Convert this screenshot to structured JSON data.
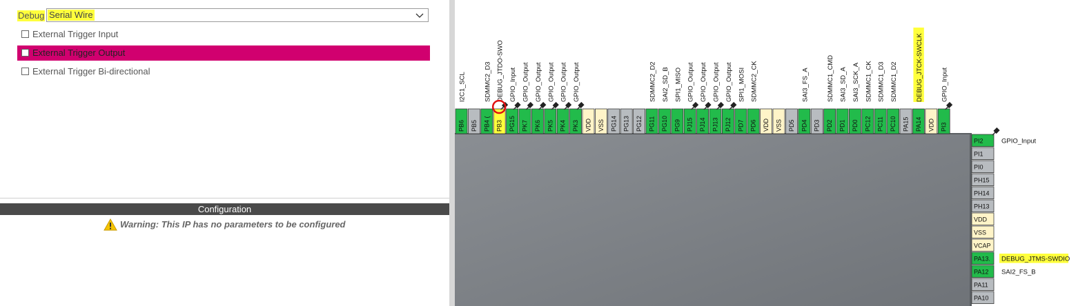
{
  "mode": {
    "debug_label": "Debug",
    "debug_value": "Serial Wire",
    "checkboxes": [
      {
        "label": "External Trigger Input",
        "checked": false,
        "selected": false
      },
      {
        "label": "External Trigger Output",
        "checked": false,
        "selected": true
      },
      {
        "label": "External Trigger Bi-directional",
        "checked": false,
        "selected": false
      }
    ]
  },
  "configuration": {
    "title": "Configuration",
    "warning": "Warning: This IP has no parameters to be configured"
  },
  "colors": {
    "gpio_green": "#22bb4b",
    "gray_pin": "#b8bcc0",
    "power_pin": "#fff4c8",
    "highlight_yellow": "#ffff3c",
    "selected_row": "#d1006f",
    "chip_body": "#7d8186"
  },
  "top_pins": [
    {
      "name": "PB6",
      "type": "gpio",
      "label": "I2C1_SCL",
      "pinned": false
    },
    {
      "name": "PB5",
      "type": "gray",
      "label": "",
      "pinned": false
    },
    {
      "name": "PB4 (",
      "type": "gpio",
      "label": "SDMMC2_D3",
      "pinned": false
    },
    {
      "name": "PB3",
      "type": "yellow",
      "label": "DEBUG_JTDO-SWO",
      "pinned": true,
      "circled": true
    },
    {
      "name": "PG15",
      "type": "gpio",
      "label": "GPIO_Input",
      "pinned": true
    },
    {
      "name": "PK7",
      "type": "gpio",
      "label": "GPIO_Output",
      "pinned": true
    },
    {
      "name": "PK6",
      "type": "gpio",
      "label": "GPIO_Output",
      "pinned": true
    },
    {
      "name": "PK5",
      "type": "gpio",
      "label": "GPIO_Output",
      "pinned": true
    },
    {
      "name": "PK4",
      "type": "gpio",
      "label": "GPIO_Output",
      "pinned": true
    },
    {
      "name": "PK3",
      "type": "gpio",
      "label": "GPIO_Output",
      "pinned": true
    },
    {
      "name": "VDD",
      "type": "power",
      "label": "",
      "pinned": false
    },
    {
      "name": "VSS",
      "type": "power",
      "label": "",
      "pinned": false
    },
    {
      "name": "PG14",
      "type": "gray",
      "label": "",
      "pinned": false
    },
    {
      "name": "PG13",
      "type": "gray",
      "label": "",
      "pinned": false
    },
    {
      "name": "PG12",
      "type": "gray",
      "label": "",
      "pinned": false
    },
    {
      "name": "PG11",
      "type": "gpio",
      "label": "SDMMC2_D2",
      "pinned": false
    },
    {
      "name": "PG10",
      "type": "gpio",
      "label": "SAI2_SD_B",
      "pinned": false
    },
    {
      "name": "PG9",
      "type": "gpio",
      "label": "SPI1_MISO",
      "pinned": false
    },
    {
      "name": "PJ15",
      "type": "gpio",
      "label": "GPIO_Output",
      "pinned": true
    },
    {
      "name": "PJ14",
      "type": "gpio",
      "label": "GPIO_Output",
      "pinned": true
    },
    {
      "name": "PJ13",
      "type": "gpio",
      "label": "GPIO_Output",
      "pinned": true
    },
    {
      "name": "PJ12",
      "type": "gpio",
      "label": "GPIO_Output",
      "pinned": true
    },
    {
      "name": "PD7",
      "type": "gpio",
      "label": "SPI1_MOSI",
      "pinned": false
    },
    {
      "name": "PD6",
      "type": "gpio",
      "label": "SDMMC2_CK",
      "pinned": false
    },
    {
      "name": "VDD",
      "type": "power",
      "label": "",
      "pinned": false
    },
    {
      "name": "VSS",
      "type": "power",
      "label": "",
      "pinned": false
    },
    {
      "name": "PD5",
      "type": "gray",
      "label": "",
      "pinned": false
    },
    {
      "name": "PD4",
      "type": "gpio",
      "label": "SAI3_FS_A",
      "pinned": false
    },
    {
      "name": "PD3",
      "type": "gray",
      "label": "",
      "pinned": false
    },
    {
      "name": "PD2",
      "type": "gpio",
      "label": "SDMMC1_CMD",
      "pinned": false
    },
    {
      "name": "PD1",
      "type": "gpio",
      "label": "SAI3_SD_A",
      "pinned": false
    },
    {
      "name": "PD0",
      "type": "gpio",
      "label": "SAI3_SCK_A",
      "pinned": false
    },
    {
      "name": "PC12",
      "type": "gpio",
      "label": "SDMMC1_CK",
      "pinned": false
    },
    {
      "name": "PC11",
      "type": "gpio",
      "label": "SDMMC1_D3",
      "pinned": false
    },
    {
      "name": "PC10",
      "type": "gpio",
      "label": "SDMMC1_D2",
      "pinned": false
    },
    {
      "name": "PA15",
      "type": "gray",
      "label": "",
      "pinned": false
    },
    {
      "name": "PA14",
      "type": "gpio",
      "label": "DEBUG_JTCK-SWCLK",
      "pinned": false,
      "highlight": true
    },
    {
      "name": "VDD",
      "type": "power",
      "label": "",
      "pinned": false
    },
    {
      "name": "PI3",
      "type": "gpio",
      "label": "GPIO_Input",
      "pinned": true
    }
  ],
  "right_pins": [
    {
      "name": "PI2",
      "type": "gpio",
      "label": "GPIO_Input",
      "pinned": true
    },
    {
      "name": "PI1",
      "type": "gray",
      "label": "",
      "pinned": false
    },
    {
      "name": "PI0",
      "type": "gray",
      "label": "",
      "pinned": false
    },
    {
      "name": "PH15",
      "type": "gray",
      "label": "",
      "pinned": false
    },
    {
      "name": "PH14",
      "type": "gray",
      "label": "",
      "pinned": false
    },
    {
      "name": "PH13",
      "type": "gray",
      "label": "",
      "pinned": false
    },
    {
      "name": "VDD",
      "type": "power",
      "label": "",
      "pinned": false
    },
    {
      "name": "VSS",
      "type": "power",
      "label": "",
      "pinned": false
    },
    {
      "name": "VCAP",
      "type": "power",
      "label": "",
      "pinned": false
    },
    {
      "name": "PA13.",
      "type": "gpio",
      "label": "DEBUG_JTMS-SWDIO",
      "pinned": false,
      "highlight": true
    },
    {
      "name": "PA12",
      "type": "gpio",
      "label": "SAI2_FS_B",
      "pinned": false
    },
    {
      "name": "PA11",
      "type": "gray",
      "label": "",
      "pinned": false
    },
    {
      "name": "PA10",
      "type": "gray",
      "label": "",
      "pinned": false
    }
  ]
}
